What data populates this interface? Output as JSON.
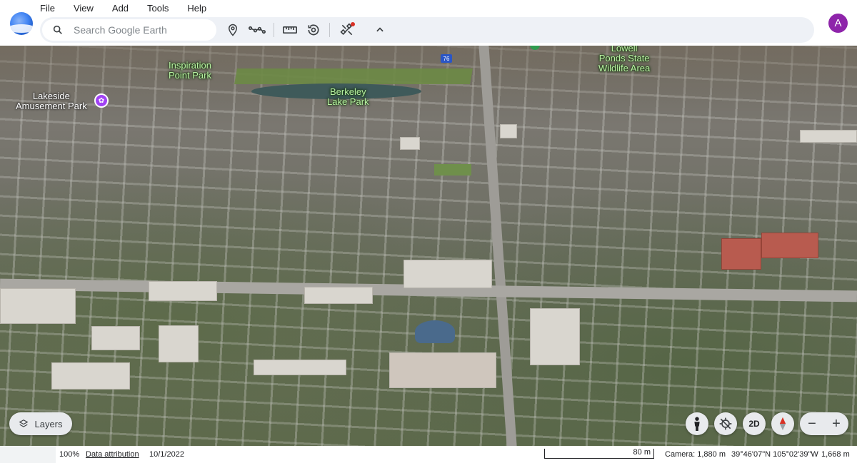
{
  "menu": [
    "File",
    "View",
    "Add",
    "Tools",
    "Help"
  ],
  "search": {
    "placeholder": "Search Google Earth"
  },
  "toolbar": {
    "icons": [
      "pin-icon",
      "path-icon",
      "ruler-icon",
      "history-icon",
      "satellite-icon",
      "chevron-up-icon"
    ]
  },
  "account": {
    "initial": "A",
    "color": "#8e24aa"
  },
  "map_labels": {
    "inspiration": "Inspiration\nPoint Park",
    "berkeley": "Berkeley\nLake Park",
    "lakeside": "Lakeside\nAmusement Park",
    "lowell": "Lowell\nPonds State\nWildlife Area",
    "route": "76"
  },
  "controls": {
    "layers": "Layers",
    "view_2d": "2D"
  },
  "status": {
    "zoom": "100%",
    "attribution": "Data attribution",
    "date": "10/1/2022",
    "scale": "80 m",
    "camera": "Camera: 1,880 m",
    "coords": "39°46'07\"N 105°02'39\"W",
    "elevation": "1,668 m"
  }
}
